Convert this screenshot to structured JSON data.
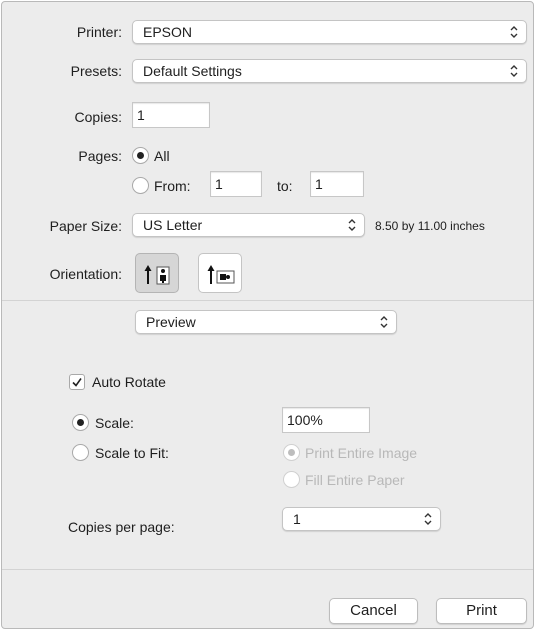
{
  "printer": {
    "label": "Printer:",
    "value": "EPSON"
  },
  "presets": {
    "label": "Presets:",
    "value": "Default Settings"
  },
  "copies": {
    "label": "Copies:",
    "value": "1"
  },
  "pages": {
    "label": "Pages:",
    "all_label": "All",
    "from_label": "From:",
    "from_value": "1",
    "to_label": "to:",
    "to_value": "1",
    "selected": "All"
  },
  "paper_size": {
    "label": "Paper Size:",
    "value": "US Letter",
    "dimensions": "8.50 by 11.00 inches"
  },
  "orientation": {
    "label": "Orientation:",
    "selected": "portrait"
  },
  "section_popup": {
    "value": "Preview"
  },
  "auto_rotate": {
    "label": "Auto Rotate",
    "checked": true
  },
  "scale": {
    "label": "Scale:",
    "value": "100%",
    "selected": true
  },
  "scale_to_fit": {
    "label": "Scale to Fit:",
    "print_entire_image": "Print Entire Image",
    "fill_entire_paper": "Fill Entire Paper"
  },
  "copies_per_page": {
    "label": "Copies per page:",
    "value": "1"
  },
  "buttons": {
    "cancel": "Cancel",
    "print": "Print"
  }
}
